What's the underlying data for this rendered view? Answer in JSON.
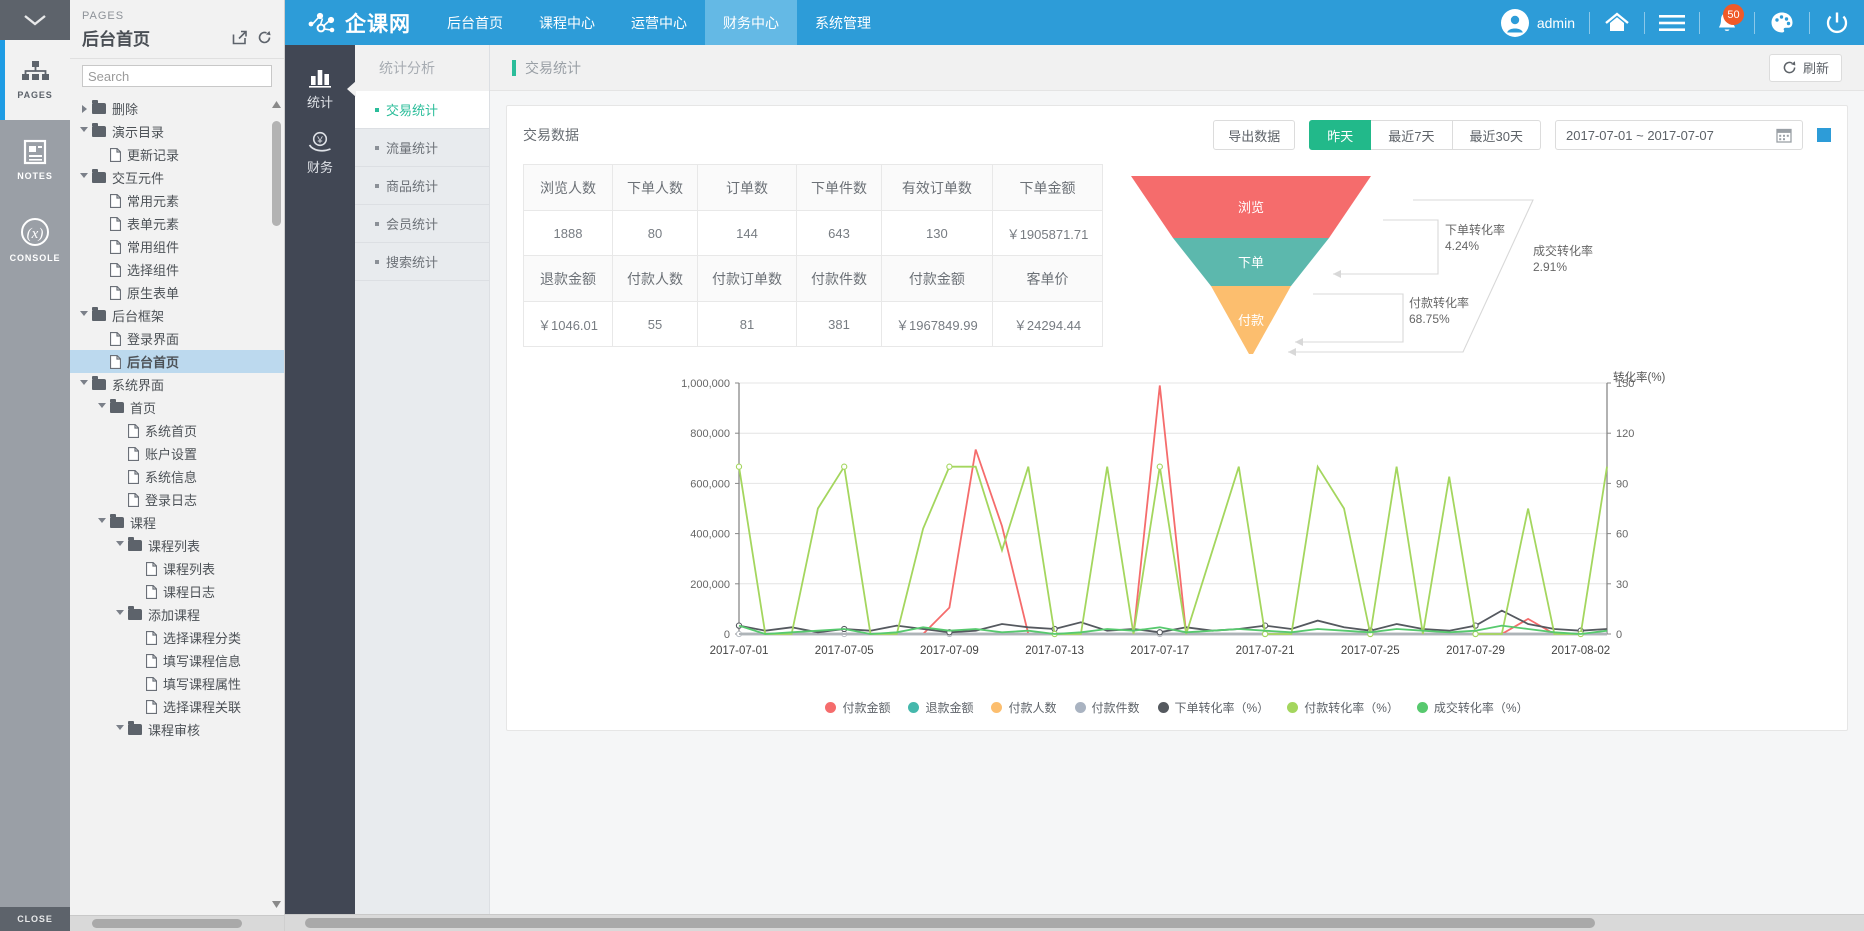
{
  "axure": {
    "rail": {
      "collapse_icon": "chevron-down-icon",
      "items": [
        {
          "label": "PAGES",
          "icon": "sitemap-icon",
          "active": true
        },
        {
          "label": "NOTES",
          "icon": "notes-icon",
          "active": false
        },
        {
          "label": "CONSOLE",
          "icon": "console-icon",
          "active": false
        }
      ],
      "close_label": "CLOSE"
    },
    "pages": {
      "kicker": "PAGES",
      "title": "后台首页",
      "open_icon": "open-in-new-icon",
      "reload_icon": "reload-icon",
      "search_placeholder": "Search",
      "search_value": "",
      "tree": [
        {
          "label": "删除",
          "type": "folder",
          "depth": 0,
          "state": "collapsed",
          "selected": false
        },
        {
          "label": "演示目录",
          "type": "folder",
          "depth": 0,
          "state": "expanded",
          "selected": false
        },
        {
          "label": "更新记录",
          "type": "page",
          "depth": 1,
          "state": "",
          "selected": false
        },
        {
          "label": "交互元件",
          "type": "folder",
          "depth": 0,
          "state": "expanded",
          "selected": false
        },
        {
          "label": "常用元素",
          "type": "page",
          "depth": 1,
          "state": "",
          "selected": false
        },
        {
          "label": "表单元素",
          "type": "page",
          "depth": 1,
          "state": "",
          "selected": false
        },
        {
          "label": "常用组件",
          "type": "page",
          "depth": 1,
          "state": "",
          "selected": false
        },
        {
          "label": "选择组件",
          "type": "page",
          "depth": 1,
          "state": "",
          "selected": false
        },
        {
          "label": "原生表单",
          "type": "page",
          "depth": 1,
          "state": "",
          "selected": false
        },
        {
          "label": "后台框架",
          "type": "folder",
          "depth": 0,
          "state": "expanded",
          "selected": false
        },
        {
          "label": "登录界面",
          "type": "page",
          "depth": 1,
          "state": "",
          "selected": false
        },
        {
          "label": "后台首页",
          "type": "page",
          "depth": 1,
          "state": "",
          "selected": true
        },
        {
          "label": "系统界面",
          "type": "folder",
          "depth": 0,
          "state": "expanded",
          "selected": false
        },
        {
          "label": "首页",
          "type": "folder",
          "depth": 1,
          "state": "expanded",
          "selected": false
        },
        {
          "label": "系统首页",
          "type": "page",
          "depth": 2,
          "state": "",
          "selected": false
        },
        {
          "label": "账户设置",
          "type": "page",
          "depth": 2,
          "state": "",
          "selected": false
        },
        {
          "label": "系统信息",
          "type": "page",
          "depth": 2,
          "state": "",
          "selected": false
        },
        {
          "label": "登录日志",
          "type": "page",
          "depth": 2,
          "state": "",
          "selected": false
        },
        {
          "label": "课程",
          "type": "folder",
          "depth": 1,
          "state": "expanded",
          "selected": false
        },
        {
          "label": "课程列表",
          "type": "folder",
          "depth": 2,
          "state": "expanded",
          "selected": false
        },
        {
          "label": "课程列表",
          "type": "page",
          "depth": 3,
          "state": "",
          "selected": false
        },
        {
          "label": "课程日志",
          "type": "page",
          "depth": 3,
          "state": "",
          "selected": false
        },
        {
          "label": "添加课程",
          "type": "folder",
          "depth": 2,
          "state": "expanded",
          "selected": false
        },
        {
          "label": "选择课程分类",
          "type": "page",
          "depth": 3,
          "state": "",
          "selected": false
        },
        {
          "label": "填写课程信息",
          "type": "page",
          "depth": 3,
          "state": "",
          "selected": false
        },
        {
          "label": "填写课程属性",
          "type": "page",
          "depth": 3,
          "state": "",
          "selected": false
        },
        {
          "label": "选择课程关联",
          "type": "page",
          "depth": 3,
          "state": "",
          "selected": false
        },
        {
          "label": "课程审核",
          "type": "folder",
          "depth": 2,
          "state": "expanded",
          "selected": false
        }
      ]
    }
  },
  "topnav": {
    "brand": "企课网",
    "brand_icon": "network-nodes-icon",
    "items": [
      {
        "label": "后台首页",
        "active": false
      },
      {
        "label": "课程中心",
        "active": false
      },
      {
        "label": "运营中心",
        "active": false
      },
      {
        "label": "财务中心",
        "active": true
      },
      {
        "label": "系统管理",
        "active": false
      }
    ],
    "user": "admin",
    "user_icon": "avatar-icon",
    "icons": [
      {
        "name": "home-icon"
      },
      {
        "name": "hamburger-menu-icon"
      },
      {
        "name": "bell-icon",
        "badge": "50"
      },
      {
        "name": "palette-icon"
      },
      {
        "name": "power-icon"
      }
    ],
    "badge_color": "#f05a28",
    "bar_color": "#2d9cd8"
  },
  "modules": [
    {
      "label": "统计",
      "icon": "bar-chart-icon",
      "active": true
    },
    {
      "label": "财务",
      "icon": "money-hand-icon",
      "active": false
    }
  ],
  "subnav": {
    "title": "统计分析",
    "items": [
      {
        "label": "交易统计",
        "active": true
      },
      {
        "label": "流量统计",
        "active": false
      },
      {
        "label": "商品统计",
        "active": false
      },
      {
        "label": "会员统计",
        "active": false
      },
      {
        "label": "搜索统计",
        "active": false
      }
    ]
  },
  "content_head": {
    "breadcrumb": "交易统计",
    "refresh_label": "刷新",
    "refresh_icon": "refresh-icon",
    "accent": "#2bbd9a"
  },
  "card": {
    "title": "交易数据",
    "export_label": "导出数据",
    "ranges": [
      {
        "label": "昨天",
        "active": true
      },
      {
        "label": "最近7天",
        "active": false
      },
      {
        "label": "最近30天",
        "active": false
      }
    ],
    "date_range": "2017-07-01 ~ 2017-07-07",
    "calendar_icon": "calendar-icon",
    "grid_toggle_icon": "grid-toggle-icon"
  },
  "stats_table": {
    "row1_headers": [
      "浏览人数",
      "下单人数",
      "订单数",
      "下单件数",
      "有效订单数",
      "下单金额"
    ],
    "row1_values": [
      "1888",
      "80",
      "144",
      "643",
      "130",
      "￥1905871.71"
    ],
    "row2_headers": [
      "退款金额",
      "付款人数",
      "付款订单数",
      "付款件数",
      "付款金额",
      "客单价"
    ],
    "row2_values": [
      "￥1046.01",
      "55",
      "81",
      "381",
      "￥1967849.99",
      "￥24294.44"
    ]
  },
  "funnel": {
    "stages": [
      {
        "label": "浏览",
        "color": "#f56c6c"
      },
      {
        "label": "下单",
        "color": "#5cb8ad"
      },
      {
        "label": "付款",
        "color": "#fcbe6e"
      }
    ],
    "annotations": [
      {
        "label": "下单转化率",
        "value": "4.24%"
      },
      {
        "label": "付款转化率",
        "value": "68.75%"
      },
      {
        "label": "成交转化率",
        "value": "2.91%"
      }
    ]
  },
  "chart_data": {
    "type": "line",
    "title": "",
    "xlabel": "",
    "ylabel": "",
    "y2label": "转化率(%)",
    "grid": true,
    "legend_position": "bottom",
    "ylim": [
      0,
      1000000
    ],
    "y2lim": [
      0,
      150
    ],
    "yticks": [
      "0",
      "200,000",
      "400,000",
      "600,000",
      "800,000",
      "1,000,000"
    ],
    "y2ticks": [
      "0",
      "30",
      "60",
      "90",
      "120",
      "150"
    ],
    "x": [
      "2017-07-01",
      "2017-07-02",
      "2017-07-03",
      "2017-07-04",
      "2017-07-05",
      "2017-07-06",
      "2017-07-07",
      "2017-07-08",
      "2017-07-09",
      "2017-07-10",
      "2017-07-11",
      "2017-07-12",
      "2017-07-13",
      "2017-07-14",
      "2017-07-15",
      "2017-07-16",
      "2017-07-17",
      "2017-07-18",
      "2017-07-19",
      "2017-07-20",
      "2017-07-21",
      "2017-07-22",
      "2017-07-23",
      "2017-07-24",
      "2017-07-25",
      "2017-07-26",
      "2017-07-27",
      "2017-07-28",
      "2017-07-29",
      "2017-07-30",
      "2017-07-31",
      "2017-08-01",
      "2017-08-02",
      "2017-08-03"
    ],
    "xticks": [
      "2017-07-01",
      "2017-07-05",
      "2017-07-09",
      "2017-07-13",
      "2017-07-17",
      "2017-07-21",
      "2017-07-25",
      "2017-07-29",
      "2017-08-02"
    ],
    "series": [
      {
        "name": "付款金额",
        "color": "#f56c6c",
        "axis": "left",
        "values": [
          0,
          0,
          0,
          0,
          0,
          0,
          0,
          0,
          105000,
          735000,
          430000,
          0,
          0,
          0,
          0,
          0,
          990000,
          0,
          0,
          0,
          0,
          0,
          0,
          0,
          0,
          0,
          0,
          0,
          0,
          0,
          60000,
          0,
          0,
          0
        ]
      },
      {
        "name": "退款金额",
        "color": "#45b8ac",
        "axis": "left",
        "values": [
          0,
          0,
          0,
          0,
          0,
          0,
          0,
          0,
          0,
          0,
          0,
          0,
          0,
          0,
          0,
          0,
          0,
          0,
          0,
          0,
          0,
          0,
          0,
          0,
          0,
          0,
          0,
          0,
          0,
          0,
          0,
          0,
          0,
          0
        ]
      },
      {
        "name": "付款人数",
        "color": "#fcbe6e",
        "axis": "left",
        "values": [
          0,
          0,
          0,
          0,
          0,
          0,
          0,
          0,
          0,
          0,
          0,
          0,
          0,
          0,
          0,
          0,
          0,
          0,
          0,
          0,
          0,
          0,
          0,
          0,
          0,
          0,
          0,
          0,
          0,
          0,
          0,
          0,
          0,
          0
        ]
      },
      {
        "name": "付款件数",
        "color": "#a9b3c1",
        "axis": "left",
        "values": [
          0,
          0,
          0,
          0,
          0,
          0,
          0,
          0,
          0,
          0,
          0,
          0,
          0,
          0,
          0,
          0,
          0,
          0,
          0,
          0,
          0,
          0,
          0,
          0,
          0,
          0,
          0,
          0,
          0,
          0,
          0,
          0,
          0,
          0
        ]
      },
      {
        "name": "下单转化率（%）",
        "color": "#55595f",
        "axis": "right",
        "values": [
          5,
          2,
          4,
          1,
          3,
          2,
          5,
          3,
          1,
          2,
          6,
          4,
          3,
          7,
          2,
          3,
          1,
          4,
          2,
          3,
          5,
          3,
          8,
          4,
          2,
          6,
          3,
          2,
          5,
          14,
          6,
          3,
          2,
          3
        ]
      },
      {
        "name": "付款转化率（%）",
        "color": "#a4d65e",
        "axis": "right",
        "values": [
          100,
          0,
          0,
          75,
          100,
          0,
          0,
          63,
          100,
          100,
          50,
          100,
          0,
          0,
          100,
          0,
          100,
          0,
          50,
          100,
          0,
          0,
          100,
          75,
          0,
          100,
          0,
          94,
          0,
          0,
          75,
          0,
          0,
          100
        ]
      },
      {
        "name": "成交转化率（%）",
        "color": "#57c96e",
        "axis": "right",
        "values": [
          5,
          0,
          1,
          2,
          3,
          0,
          1,
          4,
          2,
          3,
          1,
          2,
          0,
          1,
          3,
          2,
          4,
          1,
          2,
          3,
          2,
          1,
          3,
          2,
          1,
          3,
          2,
          1,
          2,
          5,
          3,
          1,
          0,
          2
        ]
      }
    ]
  }
}
